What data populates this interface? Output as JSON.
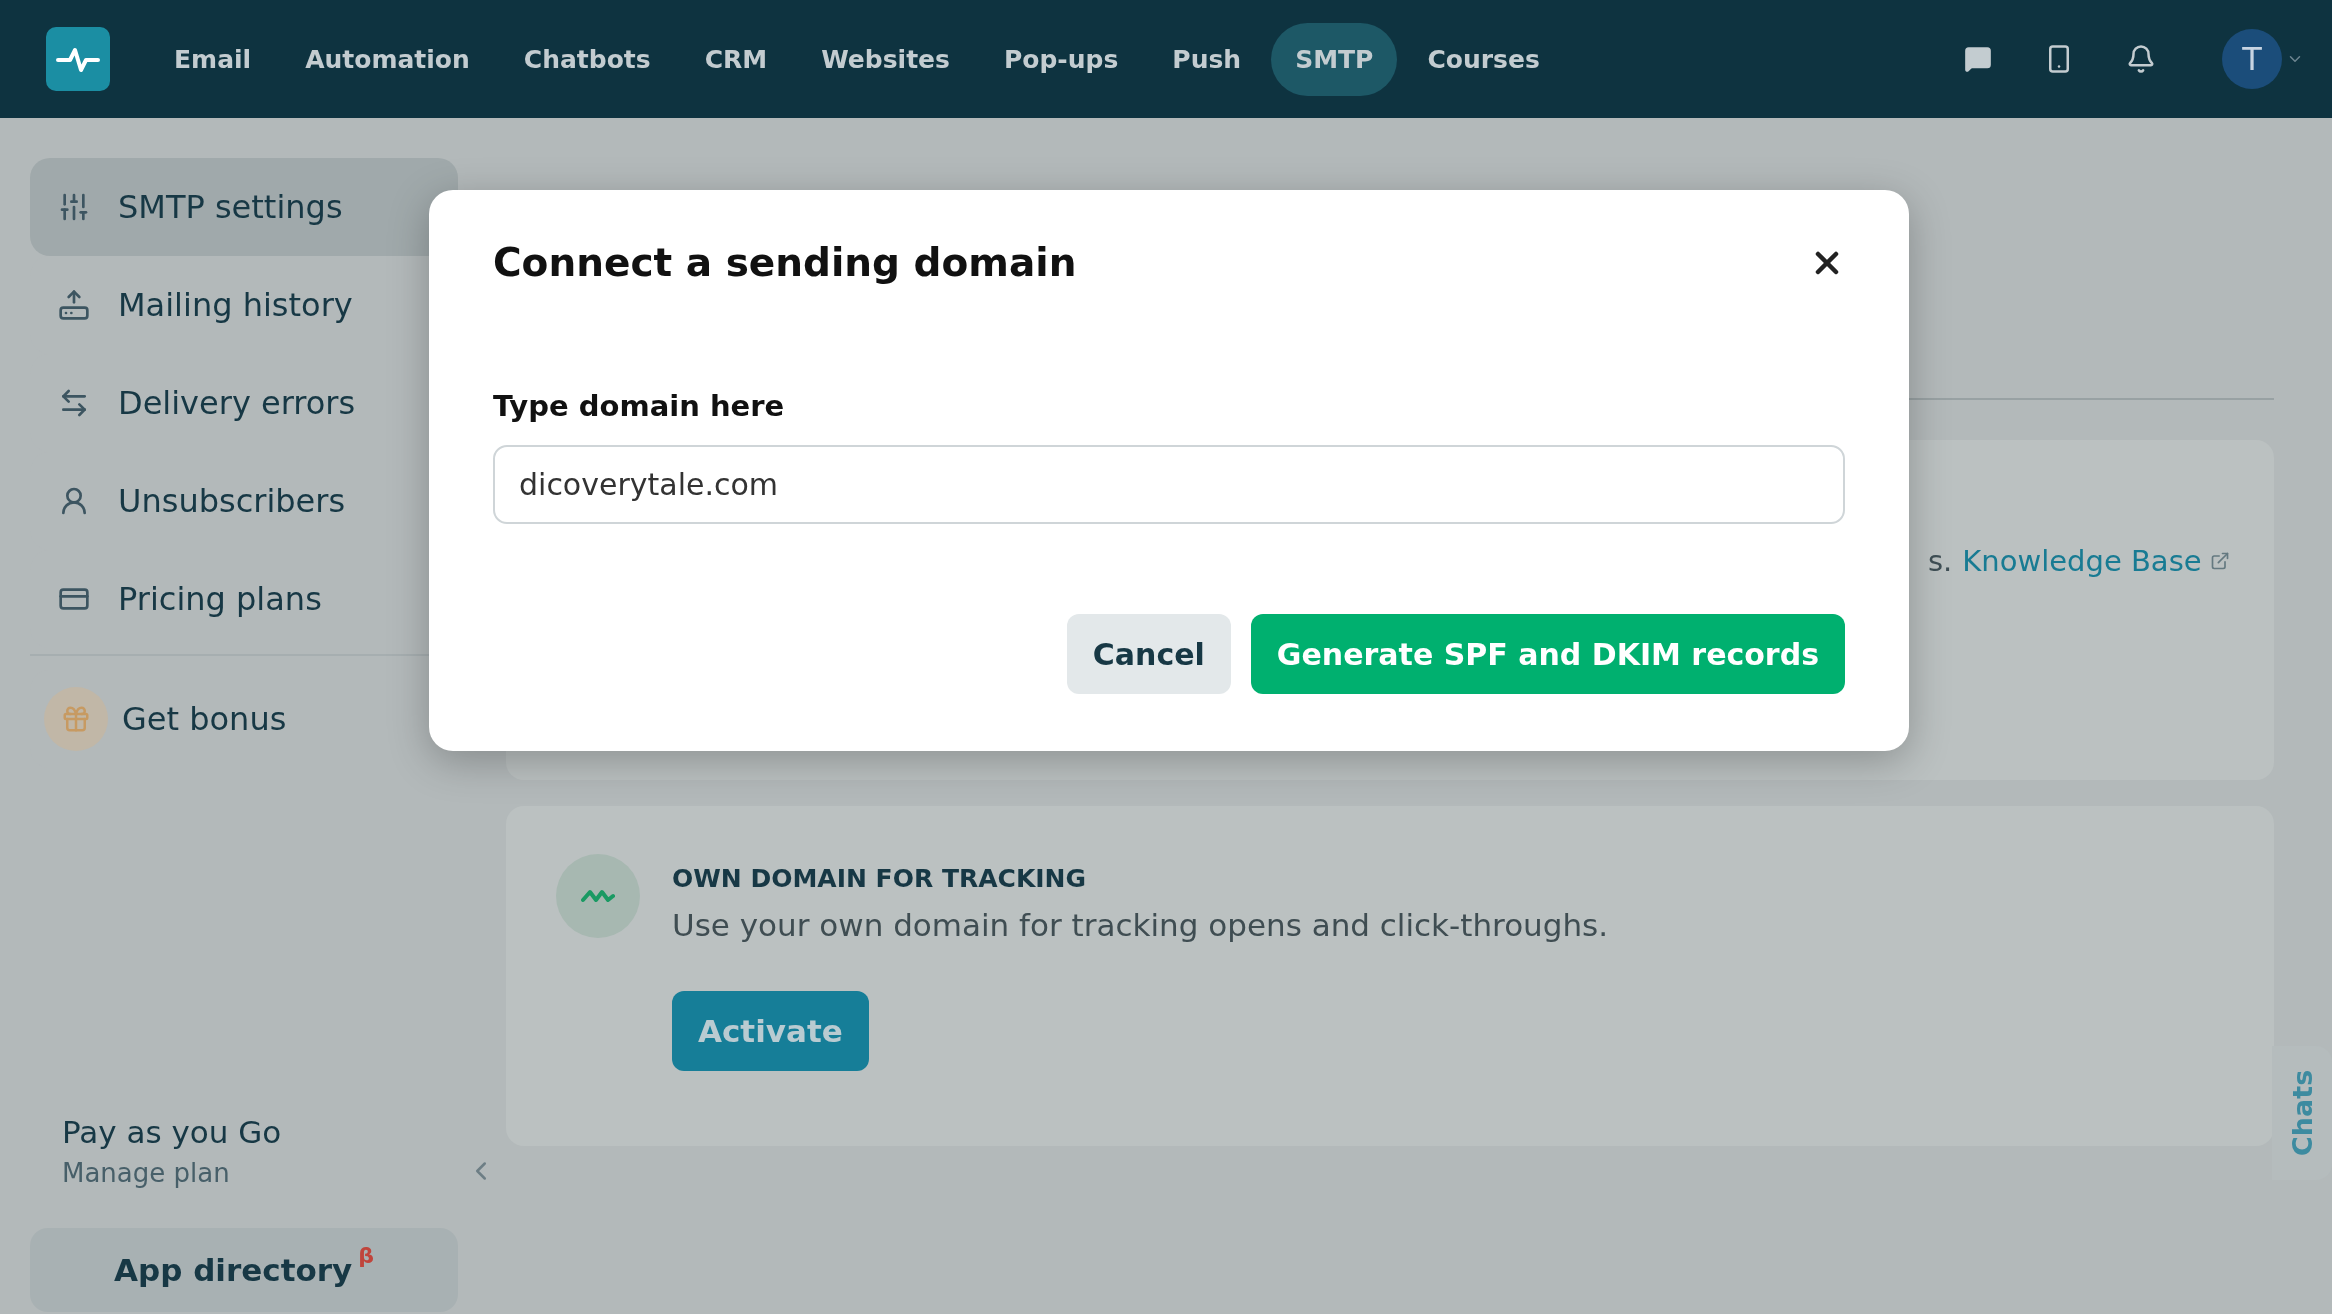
{
  "top_nav": {
    "items": [
      {
        "label": "Email",
        "selected": false
      },
      {
        "label": "Automation",
        "selected": false
      },
      {
        "label": "Chatbots",
        "selected": false
      },
      {
        "label": "CRM",
        "selected": false
      },
      {
        "label": "Websites",
        "selected": false
      },
      {
        "label": "Pop-ups",
        "selected": false
      },
      {
        "label": "Push",
        "selected": false
      },
      {
        "label": "SMTP",
        "selected": true
      },
      {
        "label": "Courses",
        "selected": false
      }
    ],
    "avatar": {
      "initial": "T"
    }
  },
  "sidebar": {
    "items": [
      {
        "label": "SMTP settings",
        "selected": true
      },
      {
        "label": "Mailing history",
        "selected": false
      },
      {
        "label": "Delivery errors",
        "selected": false
      },
      {
        "label": "Unsubscribers",
        "selected": false
      },
      {
        "label": "Pricing plans",
        "selected": false
      }
    ],
    "bonus": {
      "label": "Get bonus"
    },
    "plan": {
      "name": "Pay as you Go",
      "link": "Manage plan"
    },
    "app_directory": {
      "label": "App directory",
      "badge": "β"
    }
  },
  "content": {
    "sending_card": {
      "text_fragment": "s.",
      "link": "Knowledge Base"
    },
    "tracking_card": {
      "title": "OWN DOMAIN FOR TRACKING",
      "description": "Use your own domain for tracking opens and click-throughs.",
      "button": "Activate"
    }
  },
  "modal": {
    "title": "Connect a sending domain",
    "field_label": "Type domain here",
    "field_value": "dicoverytale.com",
    "buttons": [
      {
        "label": "Cancel",
        "kind": "secondary"
      },
      {
        "label": "Generate SPF and DKIM records",
        "kind": "primary"
      }
    ]
  },
  "chats_tab": {
    "label": "Chats"
  }
}
